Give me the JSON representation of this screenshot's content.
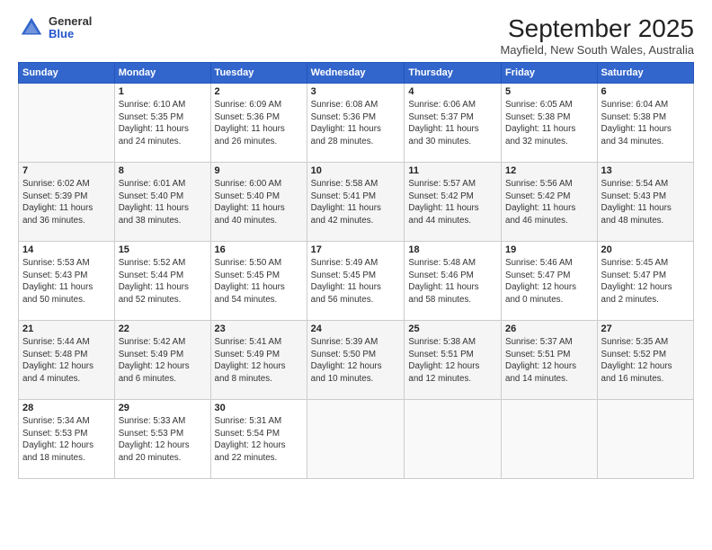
{
  "header": {
    "logo_general": "General",
    "logo_blue": "Blue",
    "title": "September 2025",
    "location": "Mayfield, New South Wales, Australia"
  },
  "columns": [
    "Sunday",
    "Monday",
    "Tuesday",
    "Wednesday",
    "Thursday",
    "Friday",
    "Saturday"
  ],
  "weeks": [
    [
      {
        "day": "",
        "info": ""
      },
      {
        "day": "1",
        "info": "Sunrise: 6:10 AM\nSunset: 5:35 PM\nDaylight: 11 hours\nand 24 minutes."
      },
      {
        "day": "2",
        "info": "Sunrise: 6:09 AM\nSunset: 5:36 PM\nDaylight: 11 hours\nand 26 minutes."
      },
      {
        "day": "3",
        "info": "Sunrise: 6:08 AM\nSunset: 5:36 PM\nDaylight: 11 hours\nand 28 minutes."
      },
      {
        "day": "4",
        "info": "Sunrise: 6:06 AM\nSunset: 5:37 PM\nDaylight: 11 hours\nand 30 minutes."
      },
      {
        "day": "5",
        "info": "Sunrise: 6:05 AM\nSunset: 5:38 PM\nDaylight: 11 hours\nand 32 minutes."
      },
      {
        "day": "6",
        "info": "Sunrise: 6:04 AM\nSunset: 5:38 PM\nDaylight: 11 hours\nand 34 minutes."
      }
    ],
    [
      {
        "day": "7",
        "info": "Sunrise: 6:02 AM\nSunset: 5:39 PM\nDaylight: 11 hours\nand 36 minutes."
      },
      {
        "day": "8",
        "info": "Sunrise: 6:01 AM\nSunset: 5:40 PM\nDaylight: 11 hours\nand 38 minutes."
      },
      {
        "day": "9",
        "info": "Sunrise: 6:00 AM\nSunset: 5:40 PM\nDaylight: 11 hours\nand 40 minutes."
      },
      {
        "day": "10",
        "info": "Sunrise: 5:58 AM\nSunset: 5:41 PM\nDaylight: 11 hours\nand 42 minutes."
      },
      {
        "day": "11",
        "info": "Sunrise: 5:57 AM\nSunset: 5:42 PM\nDaylight: 11 hours\nand 44 minutes."
      },
      {
        "day": "12",
        "info": "Sunrise: 5:56 AM\nSunset: 5:42 PM\nDaylight: 11 hours\nand 46 minutes."
      },
      {
        "day": "13",
        "info": "Sunrise: 5:54 AM\nSunset: 5:43 PM\nDaylight: 11 hours\nand 48 minutes."
      }
    ],
    [
      {
        "day": "14",
        "info": "Sunrise: 5:53 AM\nSunset: 5:43 PM\nDaylight: 11 hours\nand 50 minutes."
      },
      {
        "day": "15",
        "info": "Sunrise: 5:52 AM\nSunset: 5:44 PM\nDaylight: 11 hours\nand 52 minutes."
      },
      {
        "day": "16",
        "info": "Sunrise: 5:50 AM\nSunset: 5:45 PM\nDaylight: 11 hours\nand 54 minutes."
      },
      {
        "day": "17",
        "info": "Sunrise: 5:49 AM\nSunset: 5:45 PM\nDaylight: 11 hours\nand 56 minutes."
      },
      {
        "day": "18",
        "info": "Sunrise: 5:48 AM\nSunset: 5:46 PM\nDaylight: 11 hours\nand 58 minutes."
      },
      {
        "day": "19",
        "info": "Sunrise: 5:46 AM\nSunset: 5:47 PM\nDaylight: 12 hours\nand 0 minutes."
      },
      {
        "day": "20",
        "info": "Sunrise: 5:45 AM\nSunset: 5:47 PM\nDaylight: 12 hours\nand 2 minutes."
      }
    ],
    [
      {
        "day": "21",
        "info": "Sunrise: 5:44 AM\nSunset: 5:48 PM\nDaylight: 12 hours\nand 4 minutes."
      },
      {
        "day": "22",
        "info": "Sunrise: 5:42 AM\nSunset: 5:49 PM\nDaylight: 12 hours\nand 6 minutes."
      },
      {
        "day": "23",
        "info": "Sunrise: 5:41 AM\nSunset: 5:49 PM\nDaylight: 12 hours\nand 8 minutes."
      },
      {
        "day": "24",
        "info": "Sunrise: 5:39 AM\nSunset: 5:50 PM\nDaylight: 12 hours\nand 10 minutes."
      },
      {
        "day": "25",
        "info": "Sunrise: 5:38 AM\nSunset: 5:51 PM\nDaylight: 12 hours\nand 12 minutes."
      },
      {
        "day": "26",
        "info": "Sunrise: 5:37 AM\nSunset: 5:51 PM\nDaylight: 12 hours\nand 14 minutes."
      },
      {
        "day": "27",
        "info": "Sunrise: 5:35 AM\nSunset: 5:52 PM\nDaylight: 12 hours\nand 16 minutes."
      }
    ],
    [
      {
        "day": "28",
        "info": "Sunrise: 5:34 AM\nSunset: 5:53 PM\nDaylight: 12 hours\nand 18 minutes."
      },
      {
        "day": "29",
        "info": "Sunrise: 5:33 AM\nSunset: 5:53 PM\nDaylight: 12 hours\nand 20 minutes."
      },
      {
        "day": "30",
        "info": "Sunrise: 5:31 AM\nSunset: 5:54 PM\nDaylight: 12 hours\nand 22 minutes."
      },
      {
        "day": "",
        "info": ""
      },
      {
        "day": "",
        "info": ""
      },
      {
        "day": "",
        "info": ""
      },
      {
        "day": "",
        "info": ""
      }
    ]
  ]
}
